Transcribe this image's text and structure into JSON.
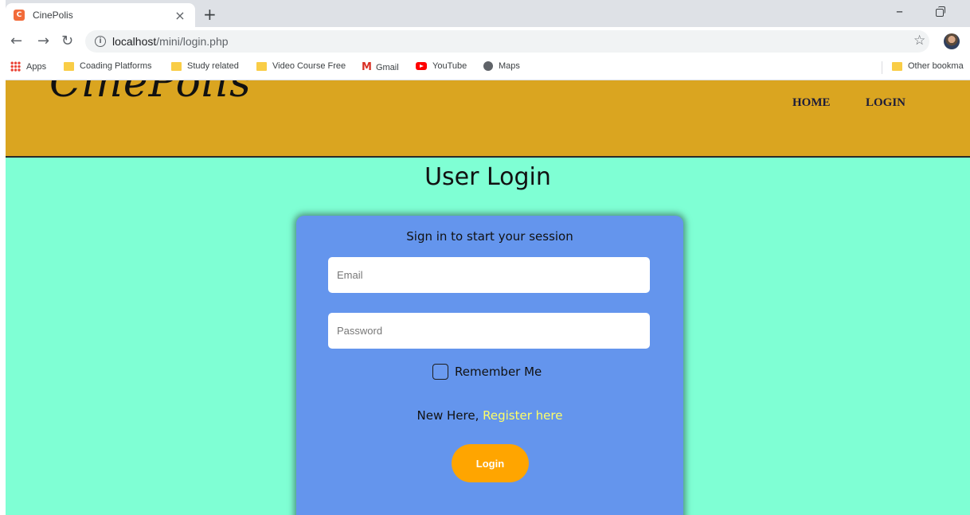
{
  "browser": {
    "tab_title": "CinePolis",
    "favicon_letter": "C",
    "new_tab": "+",
    "url_host": "localhost",
    "url_path": "/mini/login.php",
    "bookmarks": [
      {
        "label": "Apps",
        "icon": "apps-grid-icon"
      },
      {
        "label": "Coading Platforms",
        "icon": "folder-icon"
      },
      {
        "label": "Study related",
        "icon": "folder-icon"
      },
      {
        "label": "Video Course Free",
        "icon": "folder-icon"
      },
      {
        "label": "Gmail",
        "icon": "gmail-icon"
      },
      {
        "label": "YouTube",
        "icon": "youtube-icon"
      },
      {
        "label": "Maps",
        "icon": "maps-icon"
      }
    ],
    "other_bookmarks": "Other bookma"
  },
  "site": {
    "brand": "CinePolis",
    "nav": [
      {
        "label": "HOME"
      },
      {
        "label": "LOGIN"
      }
    ],
    "colors": {
      "header_bg": "#daa520",
      "page_bg": "#7fffd4",
      "card_bg": "#6495ed",
      "button_bg": "#ffa500",
      "link_color": "#ffff66"
    }
  },
  "login": {
    "title": "User Login",
    "subtitle": "Sign in to start your session",
    "email_placeholder": "Email",
    "password_placeholder": "Password",
    "remember_label": "Remember Me",
    "remember_checked": false,
    "register_prefix": "New Here,",
    "register_link": "Register here",
    "submit_label": "Login"
  }
}
